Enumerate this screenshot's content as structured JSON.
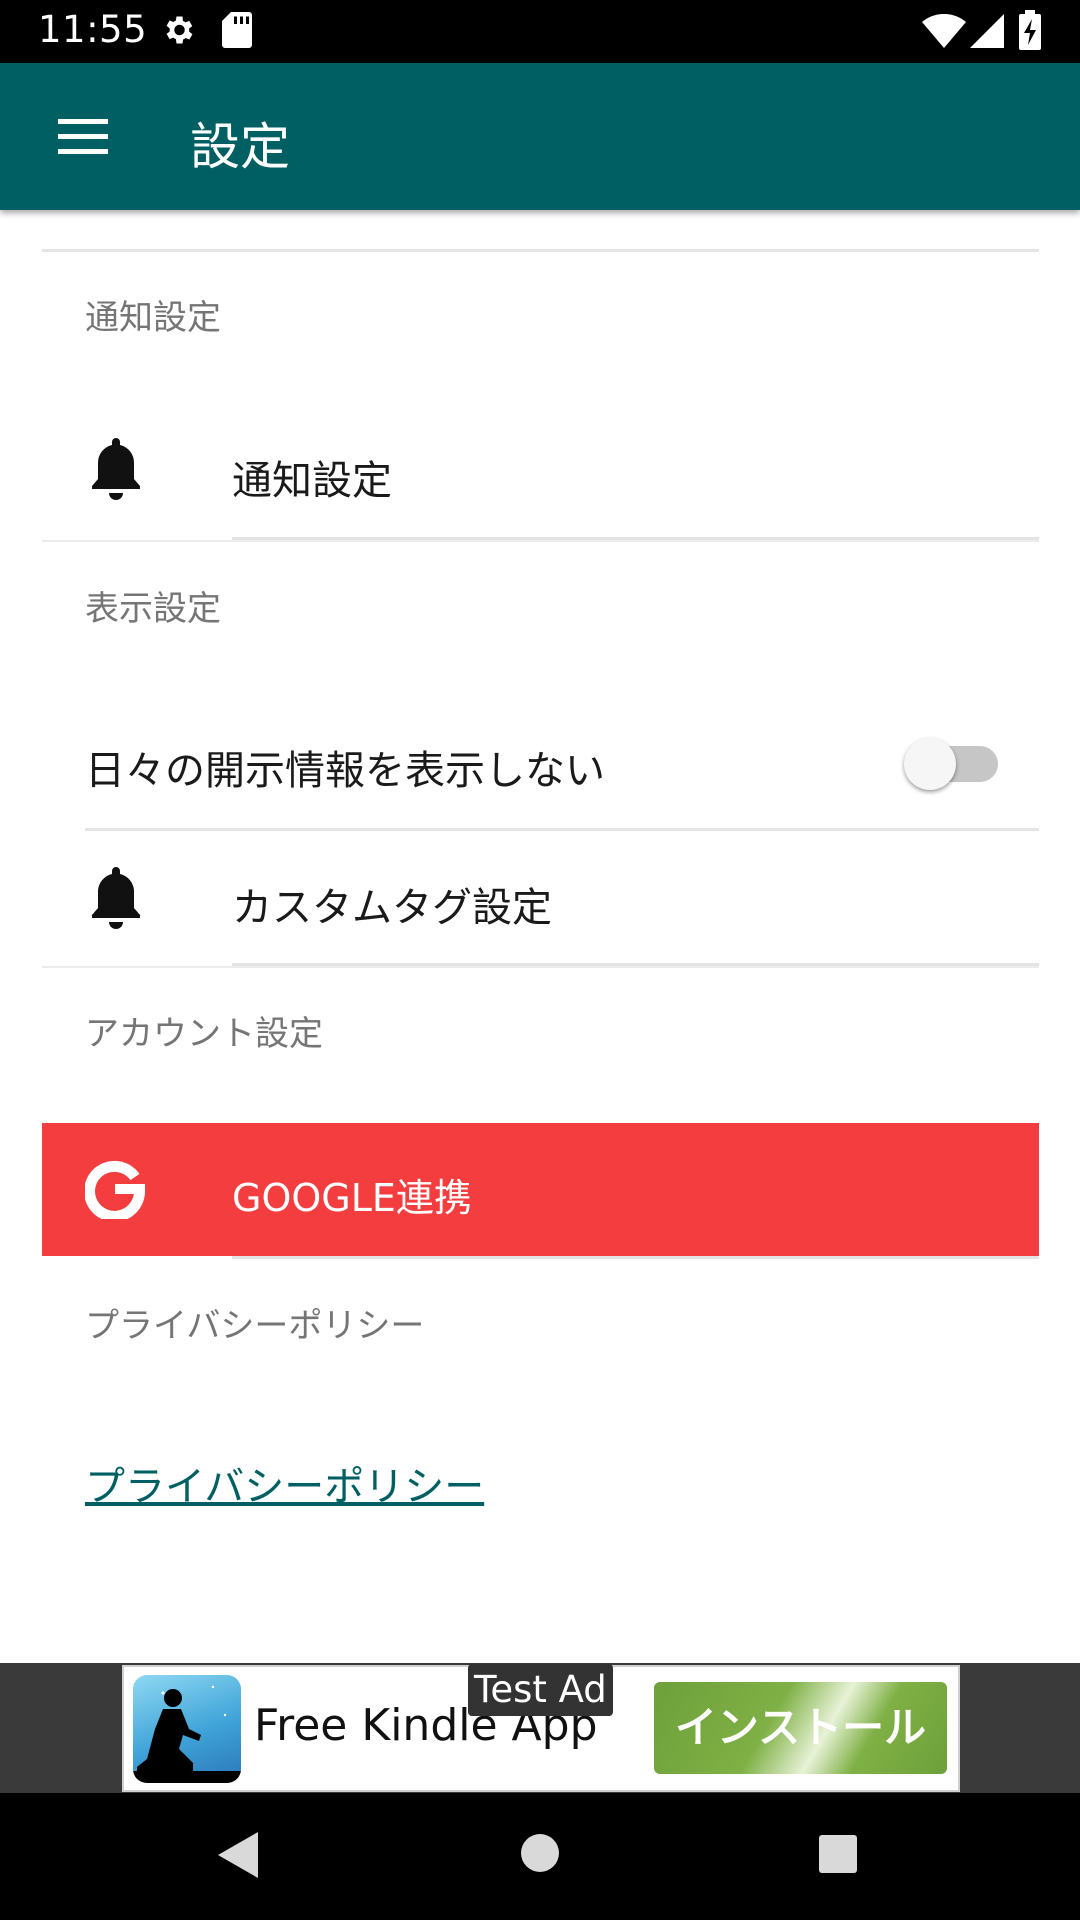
{
  "status_bar": {
    "time": "11:55",
    "icons": [
      "gear-icon",
      "sd-card-icon",
      "wifi-icon",
      "signal-icon",
      "battery-charging-icon"
    ]
  },
  "app_bar": {
    "menu_icon": "menu-icon",
    "title": "設定"
  },
  "sections": {
    "notification": {
      "category": "通知設定",
      "item_label": "通知設定",
      "item_icon": "bell-icon"
    },
    "display": {
      "category": "表示設定",
      "hide_disclosure_label": "日々の開示情報を表示しない",
      "hide_disclosure_enabled": false,
      "custom_tag_label": "カスタムタグ設定",
      "custom_tag_icon": "bell-icon"
    },
    "account": {
      "category": "アカウント設定",
      "google_label": "GOOGLE連携",
      "google_icon": "google-g-icon"
    },
    "privacy": {
      "category": "プライバシーポリシー",
      "link_label": "プライバシーポリシー"
    }
  },
  "ad": {
    "test_label": "Test Ad",
    "title": "Free Kindle App",
    "install_label": "インストール"
  },
  "nav_bar": {
    "buttons": [
      "back-icon",
      "home-icon",
      "recents-icon"
    ]
  },
  "colors": {
    "primary": "#005f63",
    "google_red": "#f33d3f",
    "install_green": "#7fb045"
  }
}
